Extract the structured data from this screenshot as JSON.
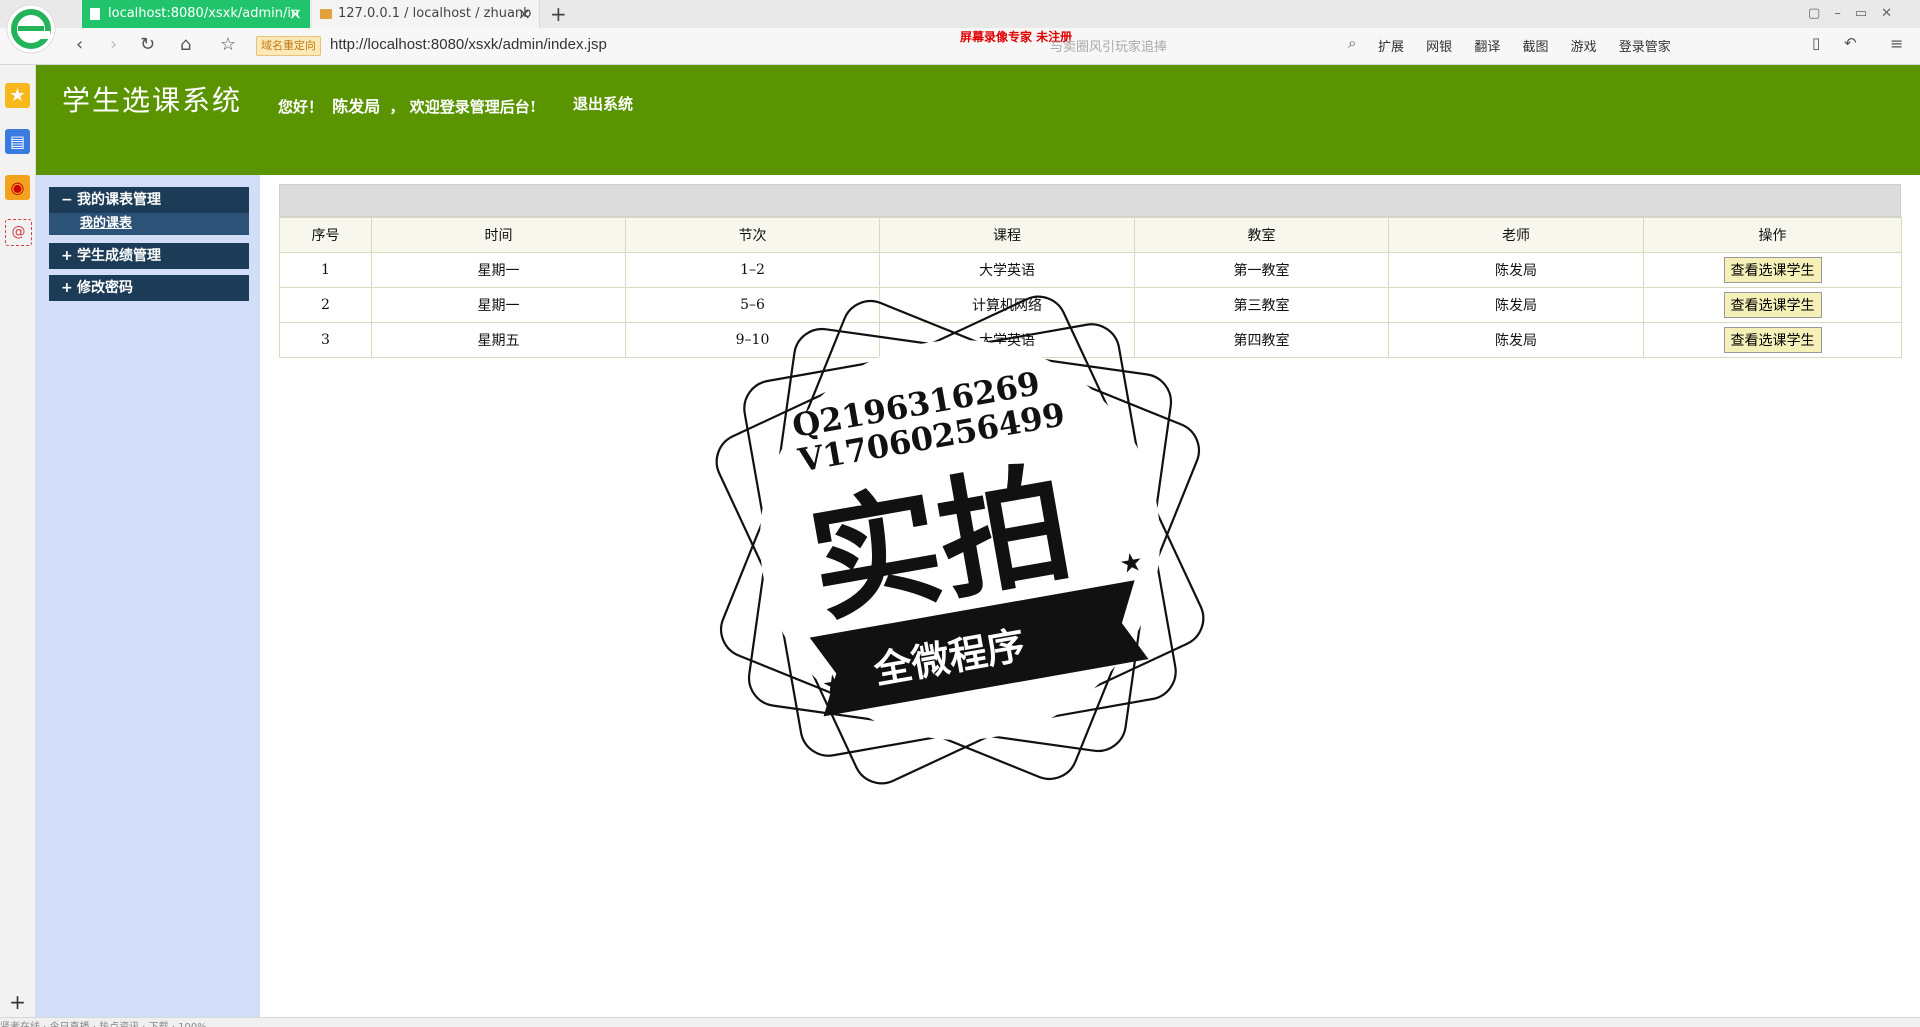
{
  "browser": {
    "tabs": [
      {
        "title": "localhost:8080/xsxk/admin/in",
        "active": true
      },
      {
        "title": "127.0.0.1 / localhost / zhuanb",
        "active": false
      }
    ],
    "new_tab": "+",
    "url_badge": "域名重定向",
    "url": "http://localhost:8080/xsxk/admin/index.jsp",
    "search_placeholder": "与卖圈风引玩家追捧",
    "recording_watermark": "屏幕录像专家  未注册",
    "tools": [
      "扩展",
      "网银",
      "翻译",
      "截图",
      "游戏",
      "登录管家"
    ],
    "status_text": "贤者在线 · 今日直播 · 热点资讯 · 下载 · 100%"
  },
  "app": {
    "title": "学生选课系统",
    "greeting_prefix": "您好！",
    "user_name": "陈发局",
    "greeting_suffix": "，  欢迎登录管理后台!",
    "logout": "退出系统"
  },
  "sidebar": {
    "groups": [
      {
        "symbol": "−",
        "label": "我的课表管理",
        "items": [
          {
            "label": "我的课表"
          }
        ]
      },
      {
        "symbol": "+",
        "label": "学生成绩管理"
      },
      {
        "symbol": "+",
        "label": "修改密码"
      }
    ]
  },
  "table": {
    "headers": [
      "序号",
      "时间",
      "节次",
      "课程",
      "教室",
      "老师",
      "操作"
    ],
    "action_label": "查看选课学生",
    "rows": [
      [
        "1",
        "星期一",
        "1–2",
        "大学英语",
        "第一教室",
        "陈发局"
      ],
      [
        "2",
        "星期一",
        "5–6",
        "计算机网络",
        "第三教室",
        "陈发局"
      ],
      [
        "3",
        "星期五",
        "9–10",
        "大学英语",
        "第四教室",
        "陈发局"
      ]
    ]
  },
  "watermark": {
    "line1": "Q2196316269",
    "line2": "V17060256499",
    "main": "实拍",
    "banner": "全微程序"
  }
}
